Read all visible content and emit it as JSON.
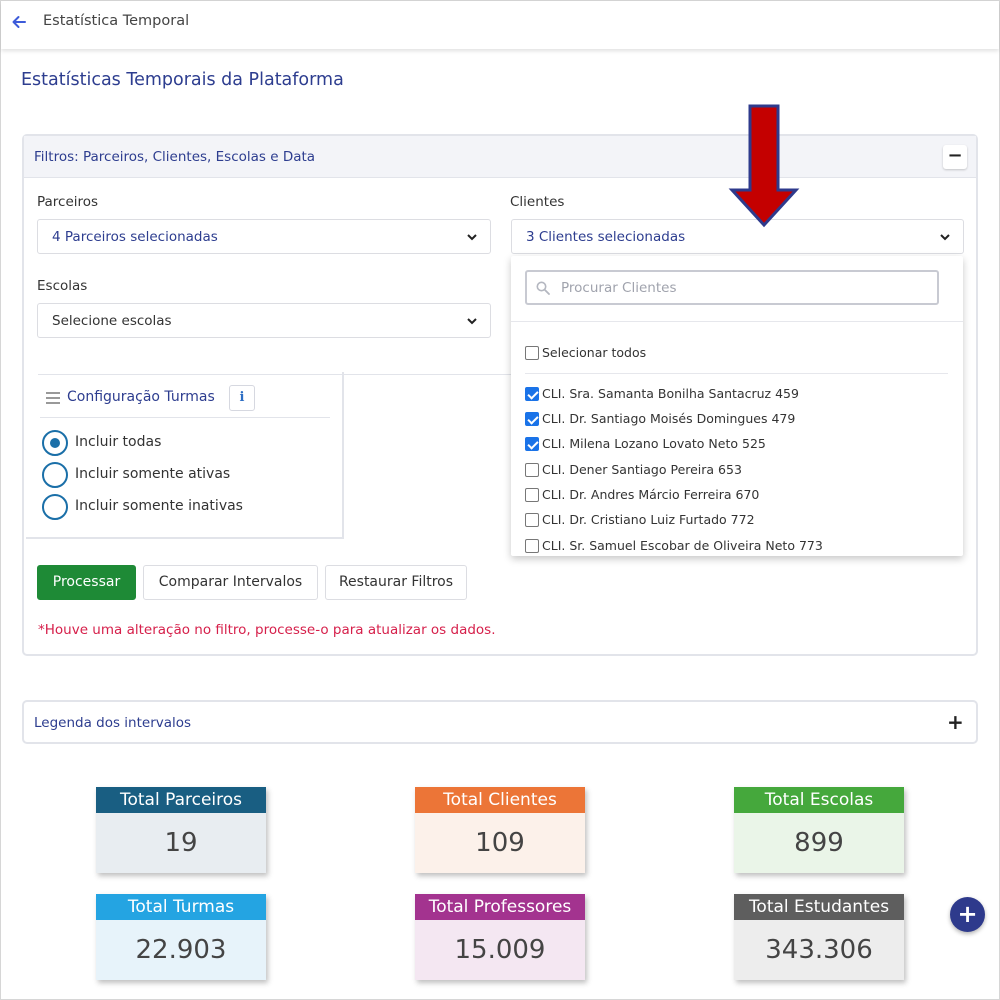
{
  "header": {
    "title": "Estatística Temporal"
  },
  "page": {
    "title": "Estatísticas Temporais da Plataforma"
  },
  "filters": {
    "title": "Filtros: Parceiros, Clientes, Escolas e Data",
    "collapse_symbol": "−",
    "partners": {
      "label": "Parceiros",
      "value": "4 Parceiros selecionadas"
    },
    "clients": {
      "label": "Clientes",
      "value": "3 Clientes selecionadas"
    },
    "schools": {
      "label": "Escolas",
      "value": "Selecione escolas"
    },
    "clients_dropdown": {
      "search_placeholder": "Procurar Clientes",
      "select_all": "Selecionar todos",
      "options": [
        {
          "label": "CLI. Sra. Samanta Bonilha Santacruz 459",
          "checked": true
        },
        {
          "label": "CLI. Dr. Santiago Moisés Domingues 479",
          "checked": true
        },
        {
          "label": "CLI. Milena Lozano Lovato Neto 525",
          "checked": true
        },
        {
          "label": "CLI. Dener Santiago Pereira 653",
          "checked": false
        },
        {
          "label": "CLI. Dr. Andres Márcio Ferreira 670",
          "checked": false
        },
        {
          "label": "CLI. Dr. Cristiano Luiz Furtado 772",
          "checked": false
        },
        {
          "label": "CLI. Sr. Samuel Escobar de Oliveira Neto 773",
          "checked": false
        }
      ]
    },
    "config": {
      "title": "Configuração Turmas",
      "info_symbol": "i",
      "options": [
        {
          "label": "Incluir todas",
          "checked": true
        },
        {
          "label": "Incluir somente ativas",
          "checked": false
        },
        {
          "label": "Incluir somente inativas",
          "checked": false
        }
      ]
    },
    "buttons": {
      "process": "Processar",
      "compare": "Comparar Intervalos",
      "reset": "Restaurar Filtros"
    },
    "alert": "*Houve uma alteração no filtro, processe-o para atualizar os dados."
  },
  "legend": {
    "title": "Legenda dos intervalos",
    "expand_symbol": "+"
  },
  "stats": [
    {
      "label": "Total Parceiros",
      "value": "19",
      "head_color": "#195e82",
      "body_color": "#e8edf1"
    },
    {
      "label": "Total Clientes",
      "value": "109",
      "head_color": "#ec7537",
      "body_color": "#fcf1ea"
    },
    {
      "label": "Total Escolas",
      "value": "899",
      "head_color": "#45a83c",
      "body_color": "#eaf5e8"
    },
    {
      "label": "Total Turmas",
      "value": "22.903",
      "head_color": "#24a4e2",
      "body_color": "#e7f3fa"
    },
    {
      "label": "Total Professores",
      "value": "15.009",
      "head_color": "#a3338f",
      "body_color": "#f4e7f2"
    },
    {
      "label": "Total Estudantes",
      "value": "343.306",
      "head_color": "#5e5e5e",
      "body_color": "#ededed"
    }
  ],
  "fab": {
    "symbol": "+"
  },
  "colors": {
    "accent": "#2d3d8f",
    "primary_button": "#1e8a36",
    "alert": "#d6204b",
    "annotation_arrow": "#c40000"
  }
}
